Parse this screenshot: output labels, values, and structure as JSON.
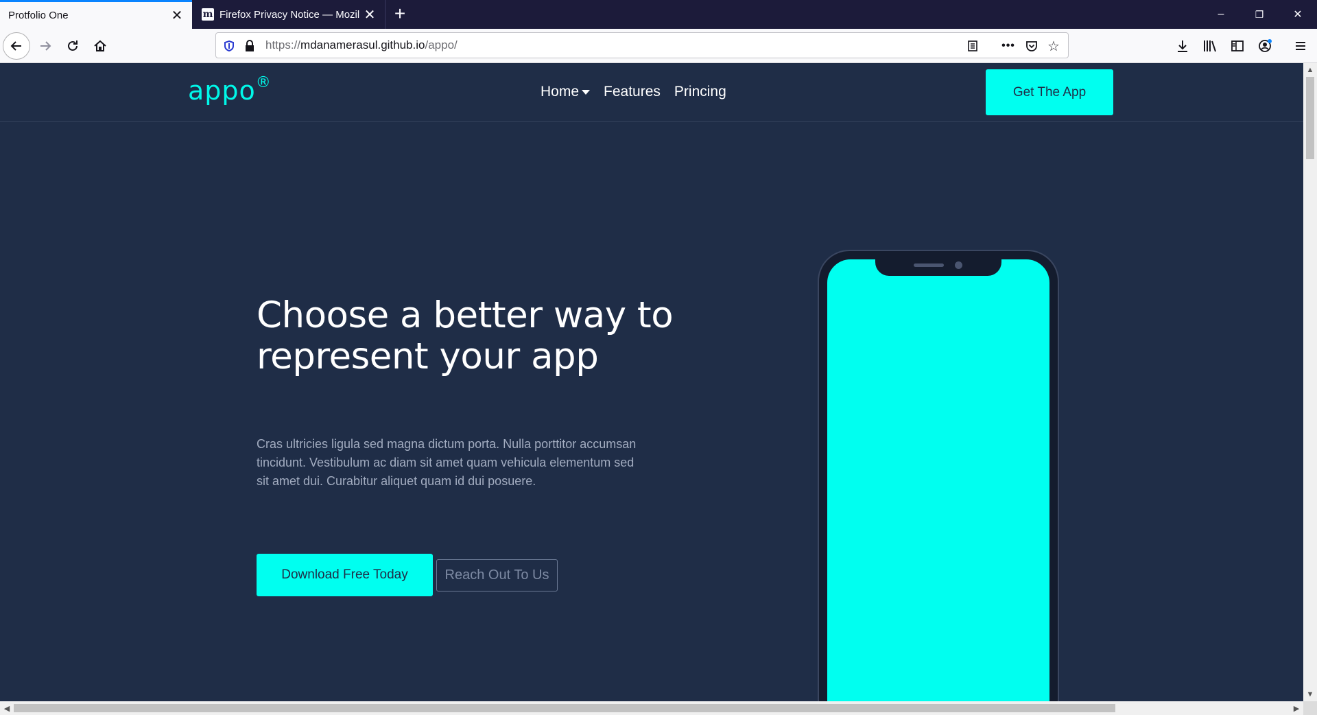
{
  "browser": {
    "tabs": [
      {
        "title": "Protfolio One",
        "active": true
      },
      {
        "title": "Firefox Privacy Notice — Mozilla",
        "active": false,
        "favicon": "m"
      }
    ],
    "new_tab_icon": "plus-icon",
    "window_controls": {
      "minimize": "–",
      "restore": "❐",
      "close": "✕"
    },
    "url": {
      "prefix": "https://",
      "host": "mdanamerasul.github.io",
      "path": "/appo/"
    },
    "toolbar_icons": [
      "back-icon",
      "forward-icon",
      "reload-icon",
      "home-icon",
      "tracking-shield-icon",
      "lock-icon",
      "reader-view-icon",
      "more-icon",
      "pocket-icon",
      "bookmark-star-icon",
      "downloads-icon",
      "library-icon",
      "sidebar-icon",
      "account-icon",
      "menu-icon"
    ]
  },
  "site": {
    "logo": "appo",
    "logo_mark": "®",
    "nav": [
      {
        "label": "Home",
        "dropdown": true
      },
      {
        "label": "Features"
      },
      {
        "label": "Princing"
      }
    ],
    "cta": "Get The App",
    "hero": {
      "title_line1": "Choose a better way to",
      "title_line2": "represent your app",
      "description": "Cras ultricies ligula sed magna dictum porta. Nulla porttitor accumsan tincidunt. Vestibulum ac diam sit amet quam vehicula elementum sed sit amet dui. Curabitur aliquet quam id dui posuere.",
      "primary_button": "Download Free Today",
      "secondary_button": "Reach Out To Us"
    }
  },
  "colors": {
    "page_bg": "#1f2d47",
    "accent": "#00fff0",
    "text_muted": "#a2acc0",
    "tabstrip_bg": "#1c1b3a"
  }
}
